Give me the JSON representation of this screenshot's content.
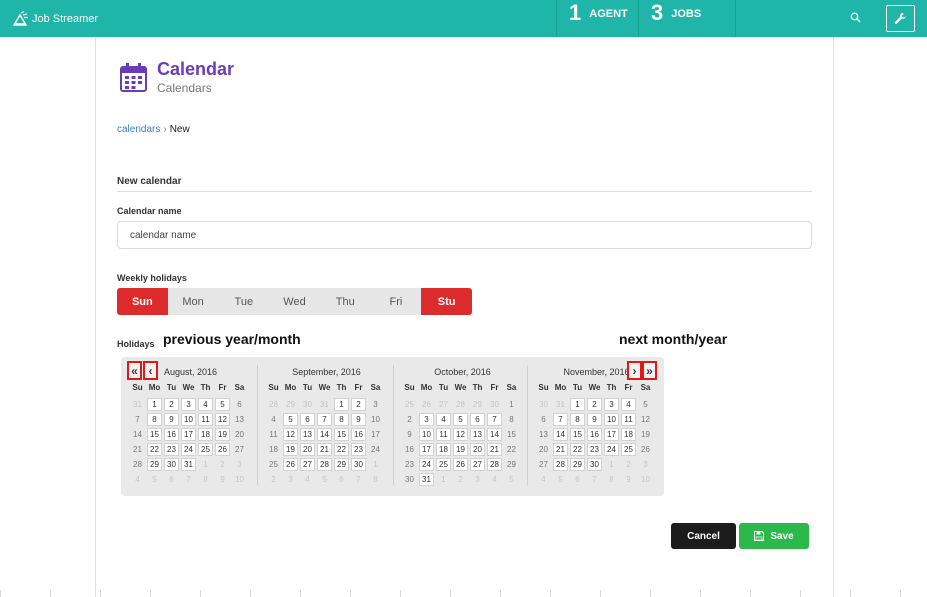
{
  "app": {
    "brand": "Job Streamer",
    "agents_count": "1",
    "agents_label": "AGENT",
    "jobs_count": "3",
    "jobs_label": "JOBS"
  },
  "icons": {
    "brand": "broadcast-logo-icon",
    "search": "search-icon",
    "tools": "wrench-icon",
    "page": "calendar-icon",
    "save": "floppy-disk-icon"
  },
  "colors": {
    "topbar": "#1fb5a8",
    "title": "#6a3db8",
    "holiday_on": "#dd2a2a",
    "save": "#2cb84a",
    "cancel": "#1c1c1c",
    "annotation_box": "#e01818"
  },
  "header": {
    "title": "Calendar",
    "subtitle": "Calendars"
  },
  "breadcrumb": {
    "link": "calendars",
    "current": "New"
  },
  "form": {
    "section_title": "New calendar",
    "name_label": "Calendar name",
    "name_placeholder": "calendar name",
    "weekly_label": "Weekly holidays",
    "weekdays": [
      {
        "label": "Sun",
        "selected": true
      },
      {
        "label": "Mon",
        "selected": false
      },
      {
        "label": "Tue",
        "selected": false
      },
      {
        "label": "Wed",
        "selected": false
      },
      {
        "label": "Thu",
        "selected": false
      },
      {
        "label": "Fri",
        "selected": false
      },
      {
        "label": "Stu",
        "selected": true
      }
    ],
    "holidays_label": "Holidays"
  },
  "annotations": {
    "prev": "previous year/month",
    "next": "next month/year"
  },
  "calendar": {
    "dow": [
      "Su",
      "Mo",
      "Tu",
      "We",
      "Th",
      "Fr",
      "Sa"
    ],
    "prev_year": "«",
    "prev_month": "‹",
    "next_month": "›",
    "next_year": "»",
    "months": [
      {
        "title": "August, 2016",
        "weeks": [
          [
            "31",
            "1",
            "2",
            "3",
            "4",
            "5",
            "6"
          ],
          [
            "7",
            "8",
            "9",
            "10",
            "11",
            "12",
            "13"
          ],
          [
            "14",
            "15",
            "16",
            "17",
            "18",
            "19",
            "20"
          ],
          [
            "21",
            "22",
            "23",
            "24",
            "25",
            "26",
            "27"
          ],
          [
            "28",
            "29",
            "30",
            "31",
            "1",
            "2",
            "3"
          ],
          [
            "4",
            "5",
            "6",
            "7",
            "8",
            "9",
            "10"
          ]
        ]
      },
      {
        "title": "September, 2016",
        "weeks": [
          [
            "28",
            "29",
            "30",
            "31",
            "1",
            "2",
            "3"
          ],
          [
            "4",
            "5",
            "6",
            "7",
            "8",
            "9",
            "10"
          ],
          [
            "11",
            "12",
            "13",
            "14",
            "15",
            "16",
            "17"
          ],
          [
            "18",
            "19",
            "20",
            "21",
            "22",
            "23",
            "24"
          ],
          [
            "25",
            "26",
            "27",
            "28",
            "29",
            "30",
            "1"
          ],
          [
            "2",
            "3",
            "4",
            "5",
            "6",
            "7",
            "8"
          ]
        ]
      },
      {
        "title": "October, 2016",
        "weeks": [
          [
            "25",
            "26",
            "27",
            "28",
            "29",
            "30",
            "1"
          ],
          [
            "2",
            "3",
            "4",
            "5",
            "6",
            "7",
            "8"
          ],
          [
            "9",
            "10",
            "11",
            "12",
            "13",
            "14",
            "15"
          ],
          [
            "16",
            "17",
            "18",
            "19",
            "20",
            "21",
            "22"
          ],
          [
            "23",
            "24",
            "25",
            "26",
            "27",
            "28",
            "29"
          ],
          [
            "30",
            "31",
            "1",
            "2",
            "3",
            "4",
            "5"
          ]
        ]
      },
      {
        "title": "November, 2016",
        "weeks": [
          [
            "30",
            "31",
            "1",
            "2",
            "3",
            "4",
            "5"
          ],
          [
            "6",
            "7",
            "8",
            "9",
            "10",
            "11",
            "12"
          ],
          [
            "13",
            "14",
            "15",
            "16",
            "17",
            "18",
            "19"
          ],
          [
            "20",
            "21",
            "22",
            "23",
            "24",
            "25",
            "26"
          ],
          [
            "27",
            "28",
            "29",
            "30",
            "1",
            "2",
            "3"
          ],
          [
            "4",
            "5",
            "6",
            "7",
            "8",
            "9",
            "10"
          ]
        ]
      }
    ]
  },
  "actions": {
    "cancel": "Cancel",
    "save": "Save"
  }
}
